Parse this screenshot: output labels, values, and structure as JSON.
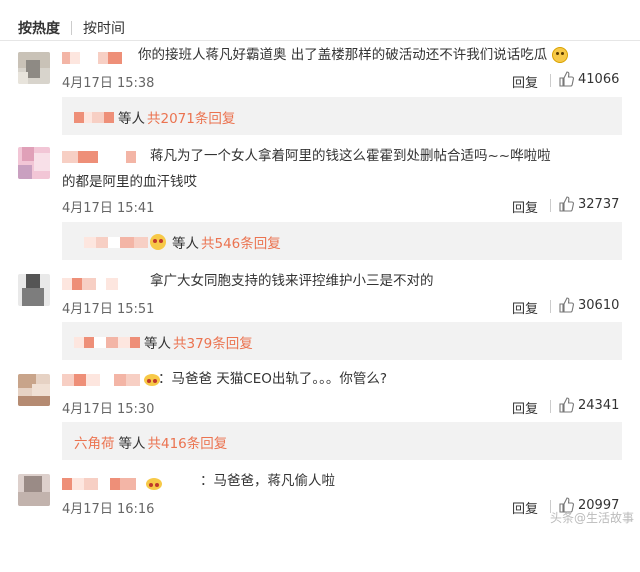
{
  "sort": {
    "hot": "按热度",
    "time": "按时间"
  },
  "comments": [
    {
      "text": "你的接班人蒋凡好霸道奥 出了盖楼那样的破活动还不许我们说话吃瓜",
      "time": "4月17日 15:38",
      "reply": "回复",
      "likes": "41066",
      "sub": {
        "deng": "等人",
        "count": "共2071条回复"
      }
    },
    {
      "text": "蒋凡为了一个女人拿着阿里的钱这么霍霍到处删帖合适吗~~哗啦啦的都是阿里的血汗钱哎",
      "time": "4月17日 15:41",
      "reply": "回复",
      "likes": "32737",
      "sub": {
        "deng": "等人",
        "count": "共546条回复"
      }
    },
    {
      "text": "拿广大女同胞支持的钱来评控维护小三是不对的",
      "time": "4月17日 15:51",
      "reply": "回复",
      "likes": "30610",
      "sub": {
        "deng": "等人",
        "count": "共379条回复"
      }
    },
    {
      "text": "：马爸爸  天猫CEO出轨了。。。你管么?",
      "time": "4月17日 15:30",
      "reply": "回复",
      "likes": "24341",
      "sub": {
        "name": "六角荷",
        "deng": "等人",
        "count": "共416条回复"
      }
    },
    {
      "text": "：马爸爸，蒋凡偷人啦",
      "time": "4月17日 16:16",
      "reply": "回复",
      "likes": "20997"
    }
  ],
  "watermark": "头条@生活故事"
}
